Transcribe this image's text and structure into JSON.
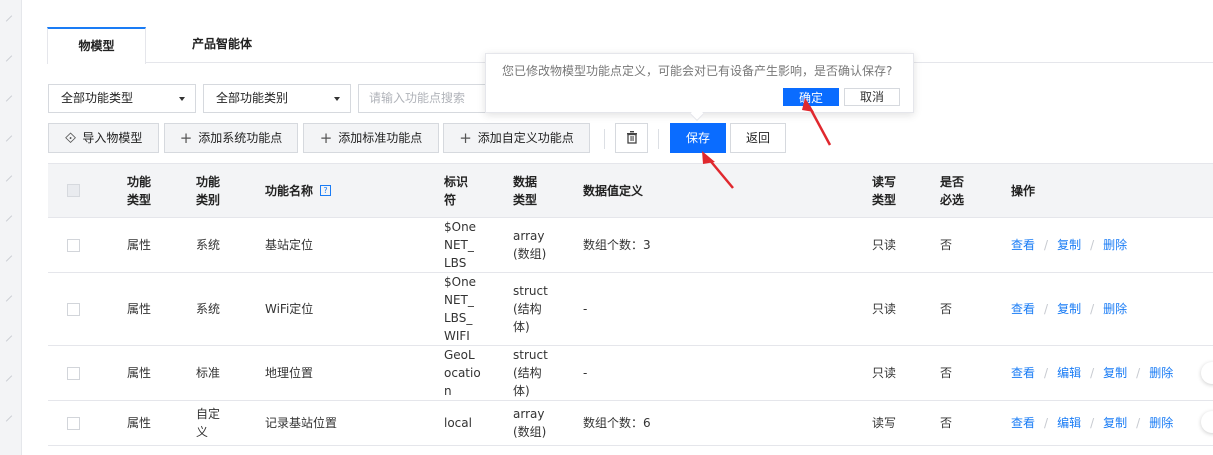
{
  "tabs": [
    "物模型",
    "产品智能体"
  ],
  "filters": {
    "type_select": "全部功能类型",
    "category_select": "全部功能类别",
    "search_placeholder": "请输入功能点搜索"
  },
  "toolbar": {
    "import": "导入物模型",
    "add_system": "添加系统功能点",
    "add_standard": "添加标准功能点",
    "add_custom": "添加自定义功能点",
    "save": "保存",
    "back": "返回"
  },
  "popconfirm": {
    "message": "您已修改物模型功能点定义，可能会对已有设备产生影响，是否确认保存?",
    "ok": "确定",
    "cancel": "取消"
  },
  "table": {
    "headers": {
      "func_type": [
        "功能",
        "类型"
      ],
      "func_category": [
        "功能",
        "类别"
      ],
      "func_name": "功能名称",
      "identifier": [
        "标识",
        "符"
      ],
      "data_type": [
        "数据",
        "类型"
      ],
      "data_def": "数据值定义",
      "rw_type": [
        "读写",
        "类型"
      ],
      "required": [
        "是否",
        "必选"
      ],
      "ops": "操作"
    },
    "rows": [
      {
        "type": "属性",
        "category": [
          "系统"
        ],
        "name": "基站定位",
        "identifier": [
          "$One",
          "NET_",
          "LBS"
        ],
        "data_type": [
          "array",
          "(数组)"
        ],
        "data_def": "数组个数：3",
        "rw": "只读",
        "required": "否",
        "ops": [
          "查看",
          "复制",
          "删除"
        ]
      },
      {
        "type": "属性",
        "category": [
          "系统"
        ],
        "name": "WiFi定位",
        "identifier": [
          "$One",
          "NET_",
          "LBS_",
          "WIFI"
        ],
        "data_type": [
          "struct",
          "(结构",
          "体)"
        ],
        "data_def": "-",
        "rw": "只读",
        "required": "否",
        "ops": [
          "查看",
          "复制",
          "删除"
        ]
      },
      {
        "type": "属性",
        "category": [
          "标准"
        ],
        "name": "地理位置",
        "identifier": [
          "GeoL",
          "ocatio",
          "n"
        ],
        "data_type": [
          "struct",
          "(结构",
          "体)"
        ],
        "data_def": "-",
        "rw": "只读",
        "required": "否",
        "ops": [
          "查看",
          "编辑",
          "复制",
          "删除"
        ]
      },
      {
        "type": "属性",
        "category": [
          "自定",
          "义"
        ],
        "name": "记录基站位置",
        "identifier": [
          "local"
        ],
        "data_type": [
          "array",
          "(数组)"
        ],
        "data_def": "数组个数：6",
        "rw": "读写",
        "required": "否",
        "ops": [
          "查看",
          "编辑",
          "复制",
          "删除"
        ]
      }
    ]
  },
  "colors": {
    "primary": "#0a6cff",
    "link": "#1a7cf5",
    "annotation_arrow": "#e0282e"
  }
}
